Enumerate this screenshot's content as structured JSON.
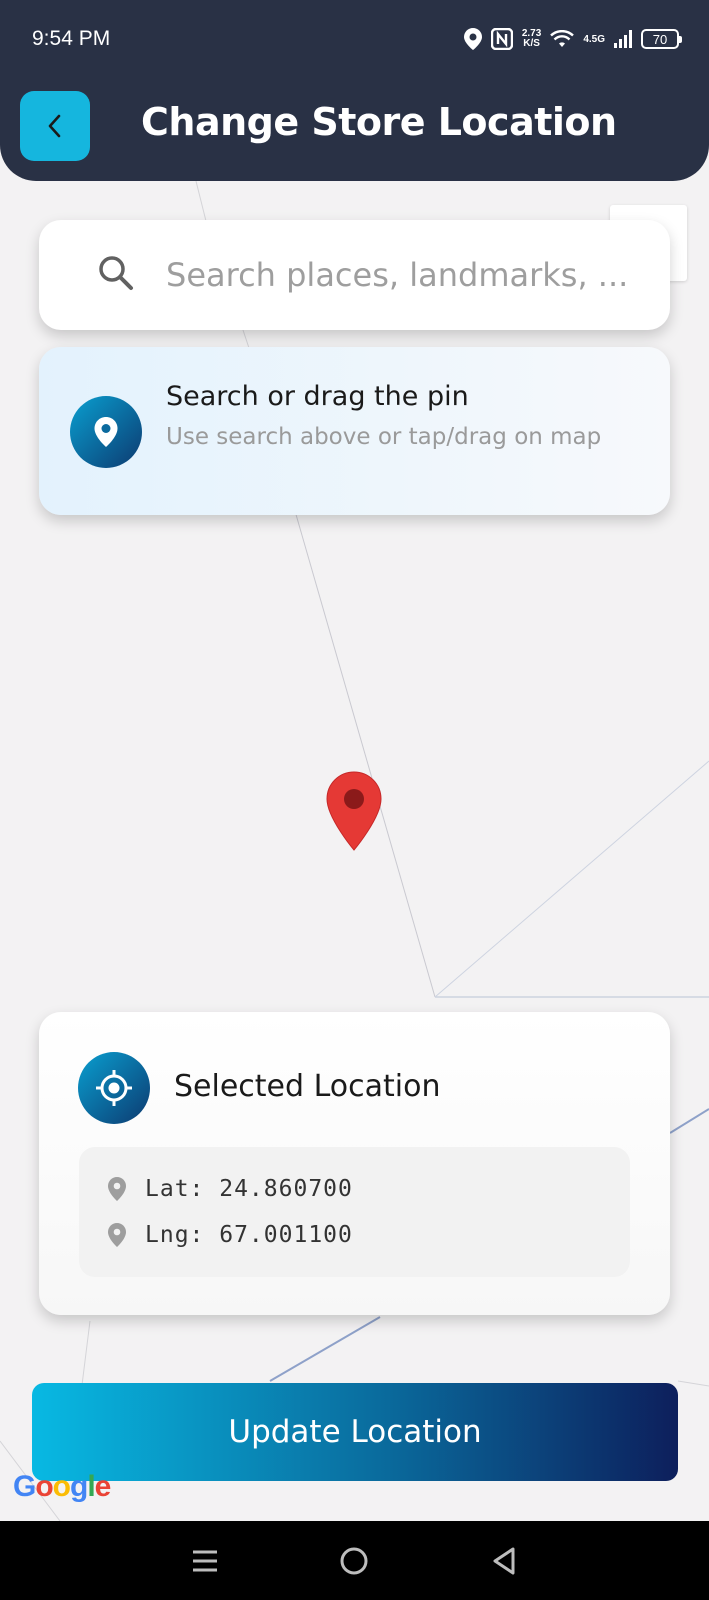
{
  "status_bar": {
    "time": "9:54 PM",
    "speed_value": "2.73",
    "speed_unit": "K/S",
    "network": "4.5G",
    "battery": "70"
  },
  "header": {
    "title": "Change Store Location"
  },
  "search": {
    "placeholder": "Search places, landmarks, ..."
  },
  "hint": {
    "title": "Search or drag the pin",
    "subtitle": "Use search above or tap/drag on map"
  },
  "selected_location": {
    "title": "Selected Location",
    "lat_label": "Lat: 24.860700",
    "lng_label": "Lng: 67.001100"
  },
  "actions": {
    "update_label": "Update Location"
  },
  "map": {
    "attribution": "Google"
  },
  "colors": {
    "header_bg": "#293145",
    "accent": "#15b6de",
    "pin": "#e53935",
    "button_gradient_start": "#08b9e3",
    "button_gradient_end": "#0d1f5c"
  },
  "icons": [
    "back-icon",
    "location-status-icon",
    "nfc-icon",
    "wifi-icon",
    "signal-icon",
    "battery-icon",
    "search-icon",
    "map-pin-icon",
    "target-icon",
    "menu-icon",
    "home-icon",
    "back-nav-icon"
  ]
}
